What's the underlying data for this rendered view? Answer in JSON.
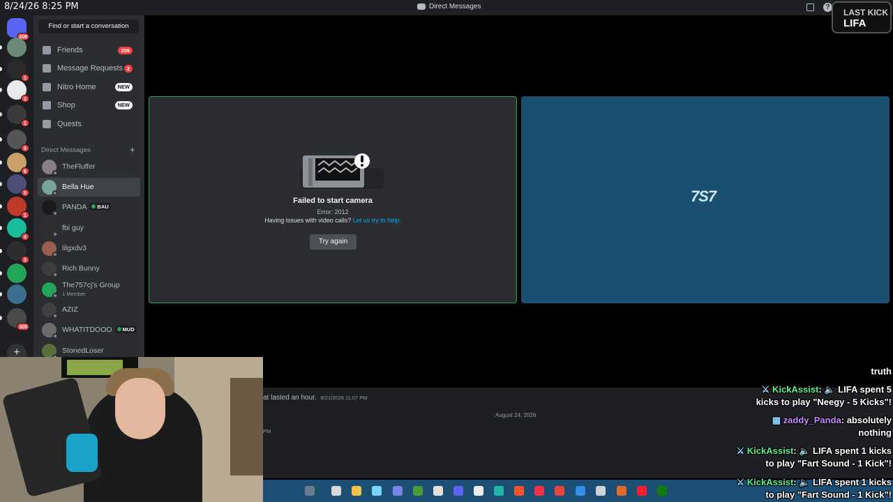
{
  "titlebar": {
    "clock": "8/24/26 8:25 PM",
    "title": "Direct Messages"
  },
  "rail": {
    "home_badge": "208",
    "servers": [
      {
        "color": "#6d8a78",
        "badge": ""
      },
      {
        "color": "#2a2a2a",
        "badge": "1"
      },
      {
        "color": "#e9e9e9",
        "badge": "1"
      },
      {
        "color": "#3a3a3a",
        "badge": "1"
      },
      {
        "color": "#555555",
        "badge": "5"
      },
      {
        "color": "#c9a06b",
        "badge": "6"
      },
      {
        "color": "#4d4d7a",
        "badge": "5"
      },
      {
        "color": "#c0392b",
        "badge": "1"
      },
      {
        "color": "#1abc9c",
        "badge": "4"
      },
      {
        "color": "#2d2d2d",
        "badge": "3"
      },
      {
        "color": "#23a55a",
        "badge": ""
      },
      {
        "color": "#3b6e8f",
        "badge": ""
      },
      {
        "color": "#4a4a4a",
        "badge": "305"
      }
    ]
  },
  "sidebar": {
    "find": "Find or start a conversation",
    "nav": [
      {
        "label": "Friends",
        "pill": "206",
        "pill_type": "red"
      },
      {
        "label": "Message Requests",
        "pill": "2",
        "pill_type": "red"
      },
      {
        "label": "Nitro Home",
        "pill": "NEW",
        "pill_type": "new"
      },
      {
        "label": "Shop",
        "pill": "NEW",
        "pill_type": "new"
      },
      {
        "label": "Quests",
        "pill": "",
        "pill_type": ""
      }
    ],
    "dm_header": "Direct Messages",
    "dm_plus": "+",
    "dms": [
      {
        "name": "TheFluffer",
        "sub": "",
        "tag": "",
        "color": "#8a7f86"
      },
      {
        "name": "Bella Hue",
        "sub": "",
        "tag": "",
        "color": "#7aa49a",
        "active": true
      },
      {
        "name": "PANDA",
        "sub": "",
        "tag": "BAU",
        "color": "#1a1a1a"
      },
      {
        "name": "fbi guy",
        "sub": "",
        "tag": "",
        "color": "#2f2f2f"
      },
      {
        "name": "lilgxdv3",
        "sub": "",
        "tag": "",
        "color": "#9b5d4c"
      },
      {
        "name": "Rich Bunny",
        "sub": "",
        "tag": "",
        "color": "#3d3d3d"
      },
      {
        "name": "The757cj's Group",
        "sub": "1 Member",
        "tag": "",
        "color": "#23a55a"
      },
      {
        "name": "AZIZ",
        "sub": "",
        "tag": "",
        "color": "#404040"
      },
      {
        "name": "WHATITDOOO",
        "sub": "",
        "tag": "MUD",
        "color": "#6b6b6b"
      },
      {
        "name": "StonedLoser",
        "sub": "",
        "tag": "",
        "color": "#5a6e3a"
      }
    ]
  },
  "call": {
    "camera_title": "Failed to start camera",
    "camera_error": "Error: 2012",
    "help_text": "Having issues with video calls?",
    "help_link": "Let us try to help.",
    "try_again": "Try again",
    "remote_logo": "7S7"
  },
  "chat": {
    "msg1_text": "at lasted an hour.",
    "msg1_time": "8/21/2026 11:07 PM",
    "date_separator": "August 24, 2026",
    "msg2_time": "PM"
  },
  "overlay": {
    "last_kick_label": "LAST KICK",
    "last_kick_name": "LIFA",
    "chat": [
      {
        "user": "",
        "text": "truth",
        "line2": ""
      },
      {
        "user": "KickAssist",
        "text": "LIFA spent 5",
        "line2": "kicks to play \"Neegy - 5 Kicks\"!"
      },
      {
        "user": "zaddy_Panda",
        "text": "absolutely",
        "line2": "nothing"
      },
      {
        "user": "KickAssist",
        "text": "LIFA spent 1 kicks",
        "line2": "to play \"Fart Sound - 1 Kick\"!"
      },
      {
        "user": "KickAssist",
        "text": "LIFA spent 1 kicks",
        "line2": "to play \"Fart Sound - 1 Kick\"!"
      }
    ]
  },
  "taskbar": {
    "icons": [
      "file-explorer-icon",
      "folder-icon",
      "copilot-icon",
      "teams-icon",
      "calculator-icon",
      "chrome-icon",
      "discord-icon",
      "github-icon",
      "app-icon",
      "brave-icon",
      "music-icon",
      "app-red-icon",
      "help-icon",
      "snip-icon",
      "app-orange-icon",
      "opera-icon",
      "xbox-icon",
      "excel-icon"
    ],
    "colors": [
      "#6b7a8c",
      "#d9d9d9",
      "#f2c14e",
      "#7ad3ff",
      "#7b83eb",
      "#4c9a3c",
      "#e0e0e0",
      "#5865f2",
      "#ececec",
      "#1fb6a6",
      "#fb542b",
      "#fa2d48",
      "#e8453c",
      "#2f8ee8",
      "#cfd4d9",
      "#e06c2c",
      "#ff1b2d",
      "#107c10",
      "#21a366"
    ]
  }
}
